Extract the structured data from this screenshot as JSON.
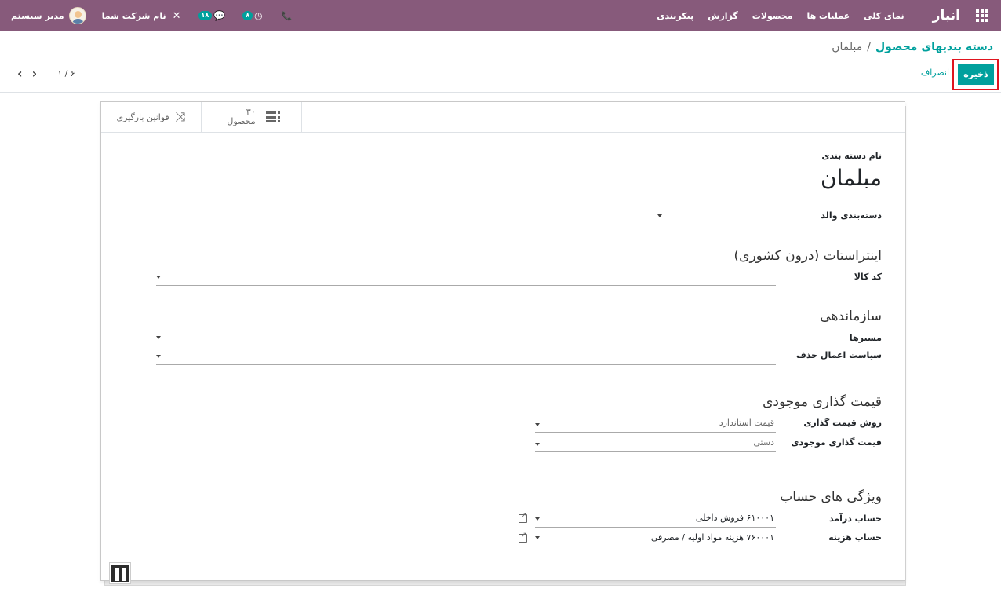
{
  "navbar": {
    "brand": "انبار",
    "menu": [
      "نمای کلی",
      "عملیات ها",
      "محصولات",
      "گزارش",
      "پیکربندی"
    ],
    "user": "مدیر سیستم",
    "company": "نام شرکت شما",
    "messages_count": "۱۸",
    "activities_count": "۸"
  },
  "control": {
    "breadcrumb_parent": "دسته بندیهای محصول",
    "breadcrumb_sep": "/",
    "breadcrumb_current": "مبلمان",
    "save_label": "ذخیره",
    "discard_label": "انصراف",
    "pager": "۱ / ۶"
  },
  "smart_buttons": {
    "products_count": "۳۰",
    "products_label": "محصول",
    "putaway_label": "قوانین بارگیری"
  },
  "form": {
    "name_label": "نام دسته بندی",
    "name_value": "مبلمان",
    "parent_label": "دسته‌بندی والد",
    "parent_value": "",
    "intrastat_title": "اینتراستات (درون کشوری)",
    "commodity_label": "کد کالا",
    "commodity_value": "",
    "logistics_title": "سازماندهی",
    "routes_label": "مسیرها",
    "routes_value": "",
    "removal_label": "سیاست اعمال حذف",
    "removal_value": "",
    "valuation_title": "قیمت گذاری موجودی",
    "costing_label": "روش قیمت گذاری",
    "costing_value": "قیمت استاندارد",
    "valuation_label": "قیمت گذاری موجودی",
    "valuation_value": "دستی",
    "account_title": "ویژگی های حساب",
    "income_label": "حساب درآمد",
    "income_value": "۶۱۰۰۰۱ فروش داخلی",
    "expense_label": "حساب هزینه",
    "expense_value": "۷۶۰۰۰۱ هزینه مواد اولیه / مصرفی"
  },
  "colors": {
    "navbar": "#875a7b",
    "accent": "#00a09d",
    "highlight": "#e0151f"
  }
}
